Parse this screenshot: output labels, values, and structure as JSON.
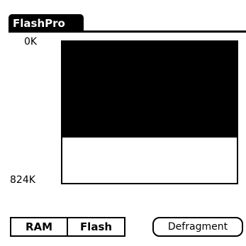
{
  "app": {
    "title": "FlashPro"
  },
  "memory_bar": {
    "top_label": "0K",
    "bottom_label": "824K",
    "used_fraction": 0.68
  },
  "segments": {
    "ram_label": "RAM",
    "flash_label": "Flash"
  },
  "actions": {
    "defragment_label": "Defragment"
  }
}
